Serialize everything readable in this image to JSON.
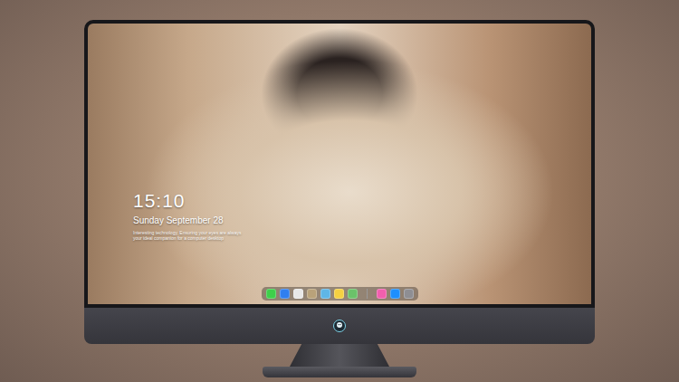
{
  "desktop": {
    "clock": {
      "time": "15:10",
      "date": "Sunday September 28",
      "caption": [
        "Interesting technology, Ensuring your eyes are always",
        "your ideal companion for a computer desktop"
      ]
    },
    "dock": {
      "items": [
        {
          "kind": "app",
          "color": "#3ecf4a"
        },
        {
          "kind": "app",
          "color": "#2f7ff0"
        },
        {
          "kind": "app",
          "color": "#e8e8e8"
        },
        {
          "kind": "app",
          "color": "#b9a27a"
        },
        {
          "kind": "app",
          "color": "#5fb6e6"
        },
        {
          "kind": "app",
          "color": "#f5d142"
        },
        {
          "kind": "app",
          "color": "#6bc26a"
        },
        {
          "kind": "separator",
          "color": "#9a9a9a"
        },
        {
          "kind": "app",
          "color": "#f15fae"
        },
        {
          "kind": "app",
          "color": "#1e8fff"
        },
        {
          "kind": "app",
          "color": "#8e8e93"
        }
      ]
    }
  }
}
